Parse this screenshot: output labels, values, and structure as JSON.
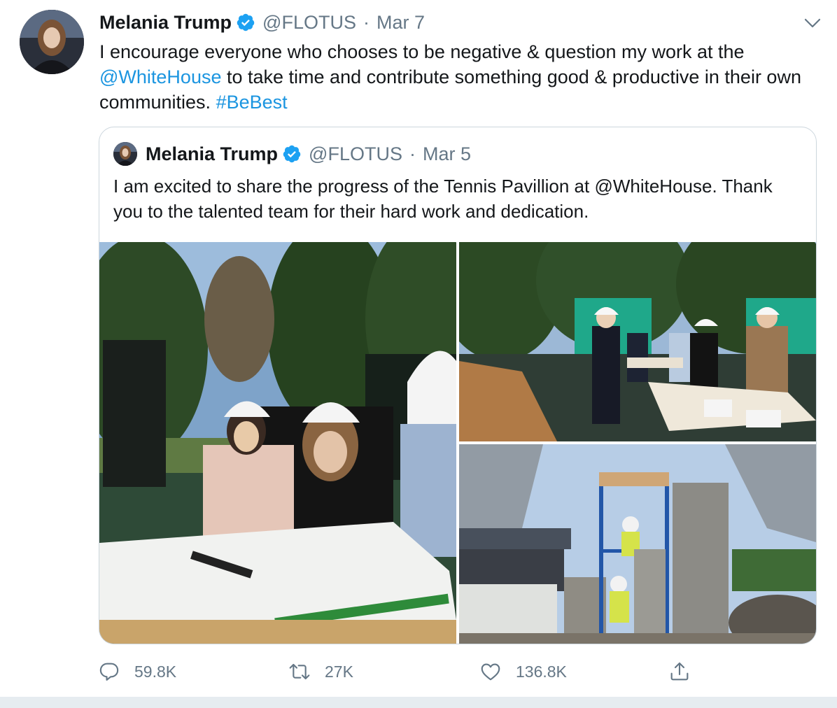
{
  "tweet": {
    "author_name": "Melania Trump",
    "handle": "@FLOTUS",
    "separator": "·",
    "date": "Mar 7",
    "text": {
      "part1": "I encourage everyone who chooses to be negative & question my work at the ",
      "mention": "@WhiteHouse",
      "part2": " to take time and contribute something good & productive in their own communities. ",
      "hashtag": "#BeBest"
    },
    "actions": {
      "replies": "59.8K",
      "retweets": "27K",
      "likes": "136.8K"
    }
  },
  "quoted_tweet": {
    "author_name": "Melania Trump",
    "handle": "@FLOTUS",
    "separator": "·",
    "date": "Mar 5",
    "text": "I am excited to share the progress of the Tennis Pavillion at @WhiteHouse. Thank you to the talented team for their hard work and dedication."
  },
  "icons": {
    "verified": "verified-badge-icon",
    "menu": "chevron-down-icon",
    "reply": "reply-icon",
    "retweet": "retweet-icon",
    "like": "heart-icon",
    "share": "share-icon"
  },
  "colors": {
    "link": "#1b95e0",
    "secondary_text": "#657786",
    "primary_text": "#14171a",
    "border": "#ccd6dd"
  }
}
